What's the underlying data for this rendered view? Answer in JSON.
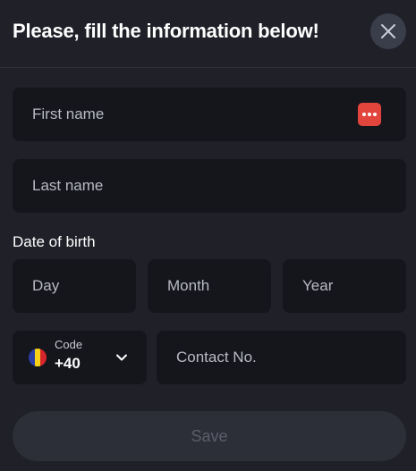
{
  "header": {
    "title": "Please, fill the information below!"
  },
  "form": {
    "first_name": {
      "placeholder": "First name"
    },
    "last_name": {
      "placeholder": "Last name"
    },
    "dob": {
      "label": "Date of birth",
      "day": "Day",
      "month": "Month",
      "year": "Year"
    },
    "phone": {
      "code_label": "Code",
      "code_value": "+40",
      "country_flag": "romania-flag",
      "contact_placeholder": "Contact No."
    },
    "save_label": "Save"
  },
  "icons": {
    "close": "close-icon",
    "autofill": "dots-icon",
    "chevron": "chevron-down-icon"
  },
  "colors": {
    "background": "#1f2028",
    "field_bg": "#15161c",
    "save_bg": "#2c2e38",
    "save_text": "#5c5f6b",
    "autofill_accent": "#e2453c",
    "flag_blue": "#2b3fa6",
    "flag_yellow": "#f7d117",
    "flag_red": "#d6262b"
  }
}
